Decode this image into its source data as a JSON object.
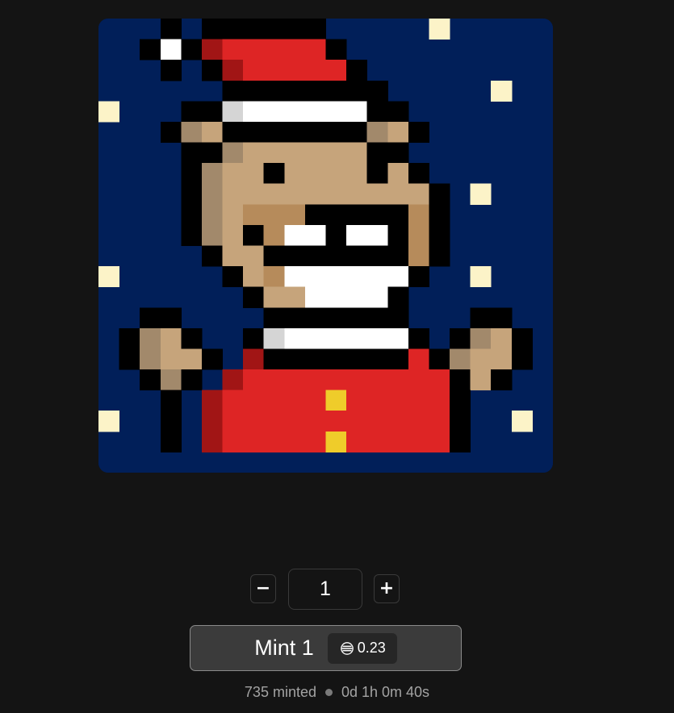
{
  "artwork": {
    "alt": "Pixel art bear in a Santa hat and red suit",
    "colors": {
      "night_sky": "#011f59",
      "snow": "#fcf3c8",
      "outline": "#000000",
      "hat_red": "#de2525",
      "hat_shadow": "#a11515",
      "trim_white": "#ffffff",
      "trim_shadow": "#d5d5d5",
      "fur": "#c6a47b",
      "fur_shadow": "#a2896b",
      "muzzle": "#b68b5b",
      "button_gold": "#efcc2a"
    }
  },
  "quantity": {
    "value": "1",
    "decrement_label": "−",
    "increment_label": "+"
  },
  "mint": {
    "label": "Mint 1",
    "price": "0.23",
    "currency_icon": "ethereum-icon"
  },
  "status": {
    "minted": "735 minted",
    "countdown": "0d 1h 0m 40s"
  }
}
